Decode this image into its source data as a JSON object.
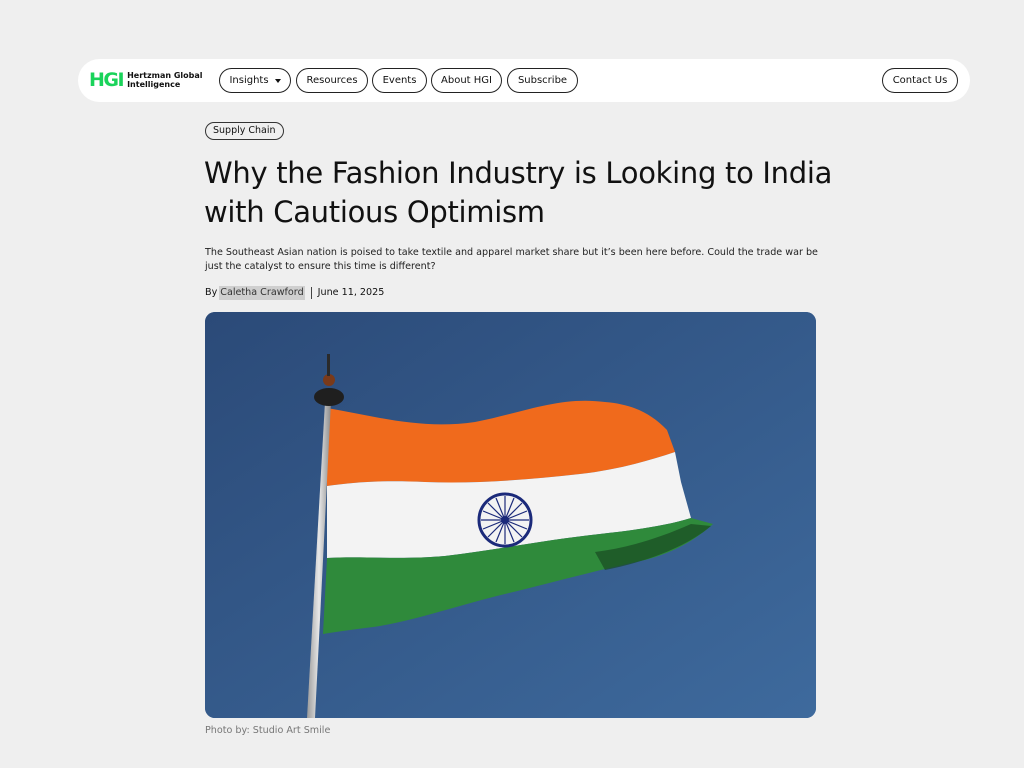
{
  "nav": {
    "logo_mark": "HGI",
    "logo_line1": "Hertzman Global",
    "logo_line2": "Intelligence",
    "items": [
      {
        "label": "Insights"
      },
      {
        "label": "Resources"
      },
      {
        "label": "Events"
      },
      {
        "label": "About HGI"
      },
      {
        "label": "Subscribe"
      }
    ],
    "contact_label": "Contact Us"
  },
  "article": {
    "category": "Supply Chain",
    "title": "Why the Fashion Industry is Looking to India with Cautious Optimism",
    "dek": "The Southeast Asian nation is poised to take textile and apparel market share but it’s been here before. Could the trade war be just the catalyst to ensure this time is different?",
    "by_prefix": "By",
    "author": "Caletha Crawford",
    "date": "June 11, 2025",
    "image_credit": "Photo by: Studio Art Smile"
  },
  "colors": {
    "brand_green": "#19d35a",
    "page_bg": "#efefef",
    "saffron": "#f26a1b",
    "flag_white": "#f4f4f4",
    "flag_green": "#2e8b3a",
    "chakra_blue": "#1b2a7a",
    "sky": "#335a8c"
  },
  "icons": {
    "dropdown": "chevron-down-icon"
  }
}
